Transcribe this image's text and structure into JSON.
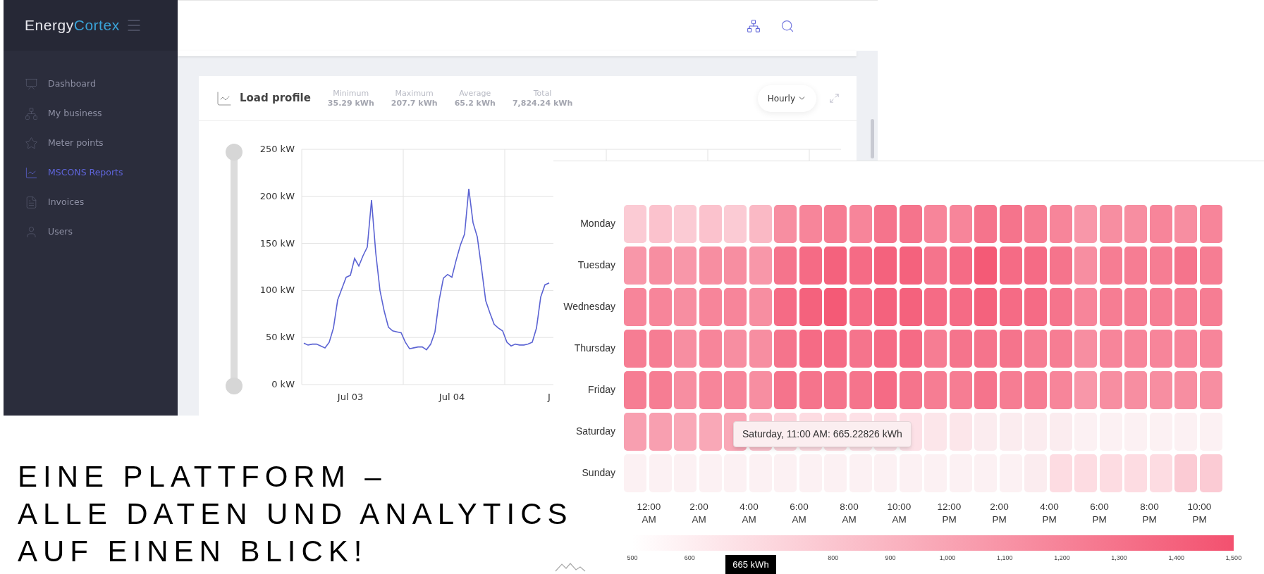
{
  "app": {
    "logo": {
      "part_1": "Energy",
      "part_2": "Cortex"
    },
    "sidebar": {
      "items": [
        {
          "label": "Dashboard",
          "selected": false
        },
        {
          "label": "My business",
          "selected": false
        },
        {
          "label": "Meter points",
          "selected": false
        },
        {
          "label": "MSCONS Reports",
          "selected": true
        },
        {
          "label": "Invoices",
          "selected": false
        },
        {
          "label": "Users",
          "selected": false
        }
      ]
    },
    "load_profile": {
      "title": "Load profile",
      "stats": [
        {
          "label": "Minimum",
          "value": "35.29 kWh"
        },
        {
          "label": "Maximum",
          "value": "207.7 kWh"
        },
        {
          "label": "Average",
          "value": "65.2 kWh"
        },
        {
          "label": "Total",
          "value": "7,824.24 kWh"
        }
      ],
      "interval": "Hourly",
      "range_slider": {
        "level": 1
      },
      "chart_data": {
        "type": "line",
        "grid": true,
        "ylim": [
          0,
          250
        ],
        "yticks": [
          {
            "value": 0,
            "label": "0 kW"
          },
          {
            "value": 50,
            "label": "50 kW"
          },
          {
            "value": 100,
            "label": "100 kW"
          },
          {
            "value": 150,
            "label": "150 kW"
          },
          {
            "value": 200,
            "label": "200 kW"
          },
          {
            "value": 250,
            "label": "250 kW"
          }
        ],
        "categories": [
          null,
          null,
          null,
          null,
          null,
          null,
          null,
          null,
          null,
          null,
          null,
          "Jul 03",
          null,
          null,
          null,
          null,
          null,
          null,
          null,
          null,
          null,
          null,
          null,
          null,
          null,
          null,
          null,
          null,
          null,
          null,
          null,
          null,
          null,
          null,
          null,
          "Jul 04",
          null,
          null,
          null,
          null,
          null,
          null,
          null,
          null,
          null,
          null,
          null,
          null,
          null,
          null,
          null,
          null,
          null,
          null,
          null,
          null,
          null,
          null,
          "J"
        ],
        "series": [
          {
            "color": "#5b63d3",
            "values": [
              44,
              42,
              43,
              43,
              41,
              39,
              45,
              60,
              90,
              102,
              114,
              116,
              134,
              126,
              137,
              146,
              196,
              140,
              100,
              78,
              61,
              57,
              56,
              55,
              45,
              38,
              39,
              40,
              40,
              37,
              43,
              56,
              90,
              113,
              117,
              114,
              132,
              148,
              160,
              208,
              172,
              157,
              124,
              89,
              76,
              64,
              60,
              57,
              45,
              41,
              43,
              42,
              42,
              43,
              45,
              60,
              93,
              106,
              108
            ]
          }
        ]
      }
    }
  },
  "heatmap": {
    "days": [
      {
        "label": "Monday",
        "cells": [
          {
            "color": "#fbcbd4"
          },
          {
            "color": "#fbc2cd"
          },
          {
            "color": "#fbcbd4"
          },
          {
            "color": "#fbc2cd"
          },
          {
            "color": "#fbcbd4"
          },
          {
            "color": "#fab9c5"
          },
          {
            "color": "#f78ea1"
          },
          {
            "color": "#f7859a"
          },
          {
            "color": "#f67d93"
          },
          {
            "color": "#f7859a"
          },
          {
            "color": "#f5748c"
          },
          {
            "color": "#f5748c"
          },
          {
            "color": "#f7859a"
          },
          {
            "color": "#f7859a"
          },
          {
            "color": "#f5748c"
          },
          {
            "color": "#f5748c"
          },
          {
            "color": "#f67d93"
          },
          {
            "color": "#f7859a"
          },
          {
            "color": "#f897a9"
          },
          {
            "color": "#f78ea1"
          },
          {
            "color": "#f78ea1"
          },
          {
            "color": "#f7859a"
          },
          {
            "color": "#f78ea1"
          },
          {
            "color": "#f7859a"
          }
        ]
      },
      {
        "label": "Tuesday",
        "cells": [
          {
            "color": "#f897a9"
          },
          {
            "color": "#f78ea1"
          },
          {
            "color": "#f897a9"
          },
          {
            "color": "#f78ea1"
          },
          {
            "color": "#f78ea1"
          },
          {
            "color": "#f897a9"
          },
          {
            "color": "#f5748c"
          },
          {
            "color": "#f56b85"
          },
          {
            "color": "#f4627d"
          },
          {
            "color": "#f56b85"
          },
          {
            "color": "#f4627d"
          },
          {
            "color": "#f4627d"
          },
          {
            "color": "#f5748c"
          },
          {
            "color": "#f56b85"
          },
          {
            "color": "#f45a76"
          },
          {
            "color": "#f56b85"
          },
          {
            "color": "#f56b85"
          },
          {
            "color": "#f5748c"
          },
          {
            "color": "#f78ea1"
          },
          {
            "color": "#f67d93"
          },
          {
            "color": "#f67d93"
          },
          {
            "color": "#f67d93"
          },
          {
            "color": "#f5748c"
          },
          {
            "color": "#f67d93"
          }
        ]
      },
      {
        "label": "Wednesday",
        "cells": [
          {
            "color": "#f7859a"
          },
          {
            "color": "#f7859a"
          },
          {
            "color": "#f78ea1"
          },
          {
            "color": "#f7859a"
          },
          {
            "color": "#f7859a"
          },
          {
            "color": "#f78ea1"
          },
          {
            "color": "#f56b85"
          },
          {
            "color": "#f4627d"
          },
          {
            "color": "#f45a76"
          },
          {
            "color": "#f56b85"
          },
          {
            "color": "#f4627d"
          },
          {
            "color": "#f4627d"
          },
          {
            "color": "#f56b85"
          },
          {
            "color": "#f56b85"
          },
          {
            "color": "#f4627d"
          },
          {
            "color": "#f56b85"
          },
          {
            "color": "#f56b85"
          },
          {
            "color": "#f5748c"
          },
          {
            "color": "#f7859a"
          },
          {
            "color": "#f67d93"
          },
          {
            "color": "#f67d93"
          },
          {
            "color": "#f67d93"
          },
          {
            "color": "#f67d93"
          },
          {
            "color": "#f67d93"
          }
        ]
      },
      {
        "label": "Thursday",
        "cells": [
          {
            "color": "#f67d93"
          },
          {
            "color": "#f67d93"
          },
          {
            "color": "#f78ea1"
          },
          {
            "color": "#f7859a"
          },
          {
            "color": "#f78ea1"
          },
          {
            "color": "#f78ea1"
          },
          {
            "color": "#f5748c"
          },
          {
            "color": "#f56b85"
          },
          {
            "color": "#f56b85"
          },
          {
            "color": "#f5748c"
          },
          {
            "color": "#f56b85"
          },
          {
            "color": "#f56b85"
          },
          {
            "color": "#f67d93"
          },
          {
            "color": "#f5748c"
          },
          {
            "color": "#f5748c"
          },
          {
            "color": "#f5748c"
          },
          {
            "color": "#f67d93"
          },
          {
            "color": "#f67d93"
          },
          {
            "color": "#f78ea1"
          },
          {
            "color": "#f7859a"
          },
          {
            "color": "#f7859a"
          },
          {
            "color": "#f7859a"
          },
          {
            "color": "#f7859a"
          },
          {
            "color": "#f7859a"
          }
        ]
      },
      {
        "label": "Friday",
        "cells": [
          {
            "color": "#f67d93"
          },
          {
            "color": "#f67d93"
          },
          {
            "color": "#f78ea1"
          },
          {
            "color": "#f7859a"
          },
          {
            "color": "#f7859a"
          },
          {
            "color": "#f78ea1"
          },
          {
            "color": "#f5748c"
          },
          {
            "color": "#f5748c"
          },
          {
            "color": "#f5748c"
          },
          {
            "color": "#f5748c"
          },
          {
            "color": "#f56b85"
          },
          {
            "color": "#f5748c"
          },
          {
            "color": "#f67d93"
          },
          {
            "color": "#f67d93"
          },
          {
            "color": "#f5748c"
          },
          {
            "color": "#f67d93"
          },
          {
            "color": "#f67d93"
          },
          {
            "color": "#f7859a"
          },
          {
            "color": "#f897a9"
          },
          {
            "color": "#f78ea1"
          },
          {
            "color": "#f78ea1"
          },
          {
            "color": "#f78ea1"
          },
          {
            "color": "#f78ea1"
          },
          {
            "color": "#f78ea1"
          }
        ]
      },
      {
        "label": "Saturday",
        "cells": [
          {
            "color": "#f89fb0"
          },
          {
            "color": "#f89fb0"
          },
          {
            "color": "#f9a8b7"
          },
          {
            "color": "#f9a8b7"
          },
          {
            "color": "#f9a8b7"
          },
          {
            "color": "#fbc2cd"
          },
          {
            "color": "#fcd3db"
          },
          {
            "color": "#fddce2"
          },
          {
            "color": "#fddce2"
          },
          {
            "color": "#fde1e7"
          },
          {
            "color": "#fde1e7"
          },
          {
            "color": "#fde1e7"
          },
          {
            "color": "#fce6ea"
          },
          {
            "color": "#fce6ea"
          },
          {
            "color": "#fbecef"
          },
          {
            "color": "#fbecef"
          },
          {
            "color": "#fbecef"
          },
          {
            "color": "#fbecef"
          },
          {
            "color": "#fcf1f3"
          },
          {
            "color": "#fcf1f3"
          },
          {
            "color": "#fcf1f3"
          },
          {
            "color": "#fcf1f3"
          },
          {
            "color": "#fcf1f3"
          },
          {
            "color": "#fcf1f3"
          }
        ]
      },
      {
        "label": "Sunday",
        "cells": [
          {
            "color": "#fcf1f3"
          },
          {
            "color": "#fcf1f3"
          },
          {
            "color": "#fcf1f3"
          },
          {
            "color": "#fcf1f3"
          },
          {
            "color": "#fcf1f3"
          },
          {
            "color": "#fcf1f3"
          },
          {
            "color": "#fcf1f3"
          },
          {
            "color": "#fcf1f3"
          },
          {
            "color": "#fcf1f3"
          },
          {
            "color": "#fcf1f3"
          },
          {
            "color": "#fcf1f3"
          },
          {
            "color": "#fcf1f3"
          },
          {
            "color": "#fcf1f3"
          },
          {
            "color": "#fcf1f3"
          },
          {
            "color": "#fcf1f3"
          },
          {
            "color": "#fcf1f3"
          },
          {
            "color": "#fbecef"
          },
          {
            "color": "#fddce2"
          },
          {
            "color": "#fddce2"
          },
          {
            "color": "#fddce2"
          },
          {
            "color": "#fddce2"
          },
          {
            "color": "#fddce2"
          },
          {
            "color": "#fbcbd4"
          },
          {
            "color": "#fbcbd4"
          }
        ]
      }
    ],
    "times": [
      "12:00 AM",
      "2:00 AM",
      "4:00 AM",
      "6:00 AM",
      "8:00 AM",
      "10:00 AM",
      "12:00 PM",
      "2:00 PM",
      "4:00 PM",
      "6:00 PM",
      "8:00 PM",
      "10:00 PM"
    ],
    "tooltip": "Saturday, 11:00 AM: 665.22826 kWh",
    "scale_ticks": [
      {
        "kind": "tick",
        "label": "500"
      },
      {
        "kind": "tick",
        "label": "600"
      },
      {
        "kind": "marker",
        "label": "665 kWh"
      },
      {
        "kind": "tick",
        "label": "800"
      },
      {
        "kind": "tick",
        "label": "900"
      },
      {
        "kind": "tick",
        "label": "1,000"
      },
      {
        "kind": "tick",
        "label": "1,100"
      },
      {
        "kind": "tick",
        "label": "1,200"
      },
      {
        "kind": "tick",
        "label": "1,300"
      },
      {
        "kind": "tick",
        "label": "1,400"
      },
      {
        "kind": "tick",
        "label": "1,500"
      }
    ]
  },
  "headline": [
    "EINE PLATTFORM –",
    "ALLE DATEN UND ANALYTICS",
    "AUF EINEN BLICK!"
  ]
}
